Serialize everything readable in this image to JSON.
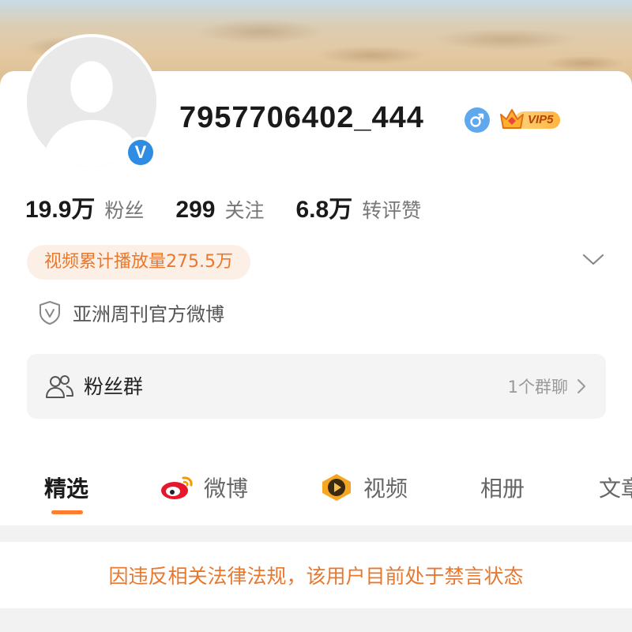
{
  "profile": {
    "username": "7957706402_444",
    "vip_label": "VIP5"
  },
  "stats": [
    {
      "value": "19.9万",
      "label": "粉丝"
    },
    {
      "value": "299",
      "label": "关注"
    },
    {
      "value": "6.8万",
      "label": "转评赞"
    }
  ],
  "play_count": "视频累计播放量275.5万",
  "official_label": "亚洲周刊官方微博",
  "fans_group": {
    "title": "粉丝群",
    "count": "1个群聊"
  },
  "tabs": [
    {
      "label": "精选",
      "active": true
    },
    {
      "label": "微博"
    },
    {
      "label": "视频"
    },
    {
      "label": "相册"
    },
    {
      "label": "文章"
    }
  ],
  "notice": "因违反相关法律法规，该用户目前处于禁言状态",
  "colors": {
    "accent": "#ff7d2c",
    "notice_text": "#e8782e",
    "verified_blue": "#2e8de2"
  },
  "icons": [
    "default-avatar",
    "verified-v-icon",
    "male-icon",
    "vip-crown-icon",
    "chevron-down-icon",
    "shield-v-icon",
    "group-people-icon",
    "chevron-right-icon",
    "weibo-logo-icon",
    "video-play-icon"
  ]
}
